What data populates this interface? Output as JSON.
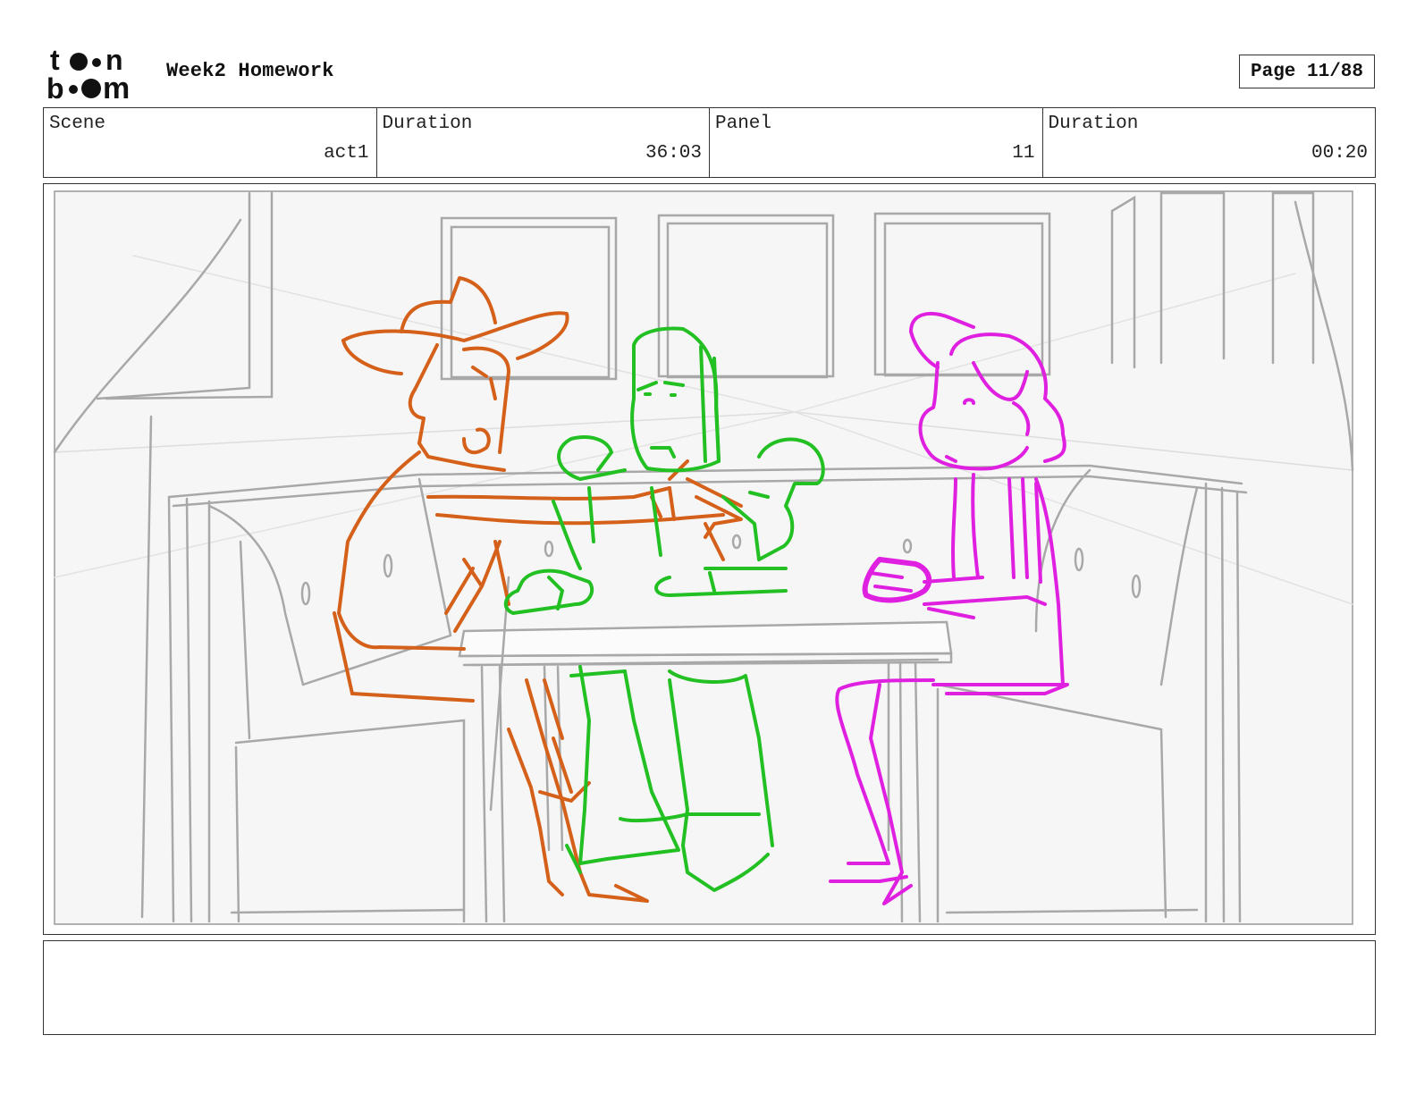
{
  "header": {
    "logo_text_top": "toon",
    "logo_text_bottom": "boom",
    "title": "Week2 Homework",
    "page": "Page 11/88"
  },
  "info": {
    "scene_label": "Scene",
    "scene_value": "act1",
    "scene_duration_label": "Duration",
    "scene_duration_value": "36:03",
    "panel_label": "Panel",
    "panel_value": "11",
    "panel_duration_label": "Duration",
    "panel_duration_value": "00:20"
  },
  "colors": {
    "sketch_gray": "#a8a8a8",
    "cowboy_orange": "#d4601a",
    "spaceman_green": "#22c022",
    "girl_magenta": "#e020e0",
    "frame_border": "#333333"
  },
  "notes": {
    "text": ""
  }
}
